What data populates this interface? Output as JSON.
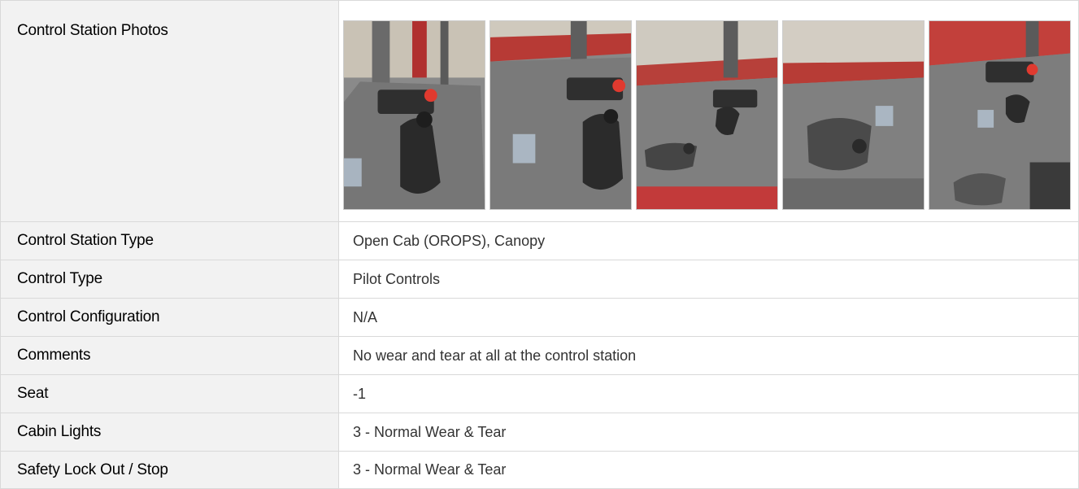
{
  "rows": [
    {
      "label": "Control Station Photos",
      "value": ""
    },
    {
      "label": "Control Station Type",
      "value": "Open Cab (OROPS), Canopy"
    },
    {
      "label": "Control Type",
      "value": "Pilot Controls"
    },
    {
      "label": "Control Configuration",
      "value": "N/A"
    },
    {
      "label": "Comments",
      "value": "No wear and tear at all at the control station"
    },
    {
      "label": "Seat",
      "value": "-1"
    },
    {
      "label": "Cabin Lights",
      "value": "3 - Normal Wear & Tear"
    },
    {
      "label": "Safety Lock Out / Stop",
      "value": "3 - Normal Wear & Tear"
    }
  ],
  "photos": [
    {
      "name": "control-station-photo-1"
    },
    {
      "name": "control-station-photo-2"
    },
    {
      "name": "control-station-photo-3"
    },
    {
      "name": "control-station-photo-4"
    },
    {
      "name": "control-station-photo-5"
    }
  ]
}
